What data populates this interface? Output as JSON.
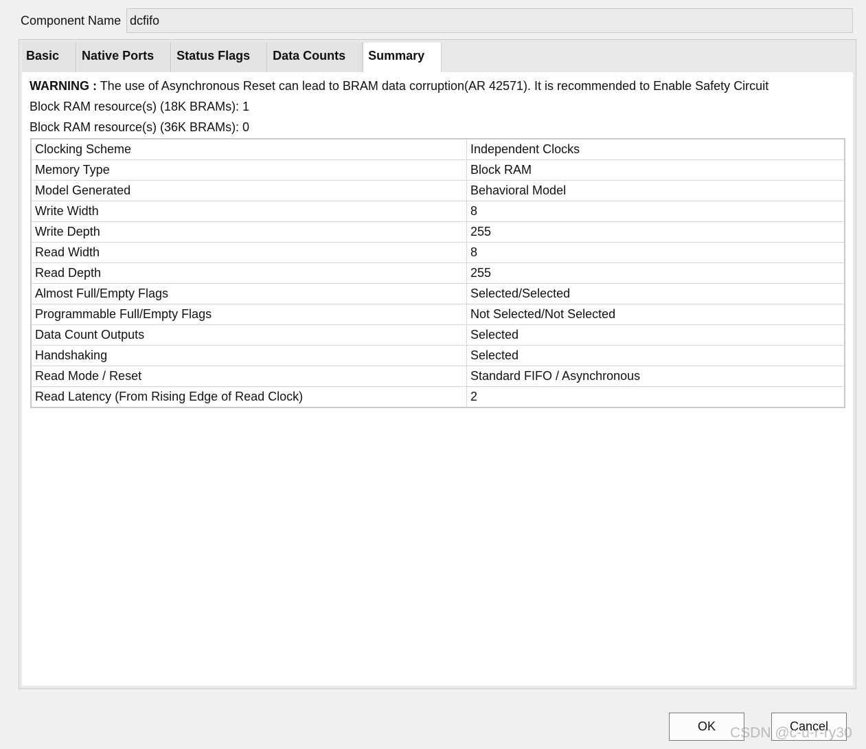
{
  "component": {
    "label": "Component Name",
    "value": "dcfifo"
  },
  "tabs": [
    {
      "label": "Basic",
      "active": false
    },
    {
      "label": "Native Ports",
      "active": false
    },
    {
      "label": "Status Flags",
      "active": false
    },
    {
      "label": "Data Counts",
      "active": false
    },
    {
      "label": "Summary",
      "active": true
    }
  ],
  "summary": {
    "warning_label": "WARNING :",
    "warning_text": "The use of Asynchronous Reset can lead to BRAM data corruption(AR 42571). It is recommended to Enable Safety Circuit",
    "bram18": "Block RAM resource(s) (18K BRAMs): 1",
    "bram36": "Block RAM resource(s) (36K BRAMs): 0",
    "rows": [
      {
        "key": "Clocking Scheme",
        "value": "Independent Clocks"
      },
      {
        "key": "Memory Type",
        "value": "Block RAM"
      },
      {
        "key": "Model Generated",
        "value": "Behavioral Model"
      },
      {
        "key": "Write Width",
        "value": "8"
      },
      {
        "key": "Write Depth",
        "value": "255"
      },
      {
        "key": "Read Width",
        "value": "8"
      },
      {
        "key": "Read Depth",
        "value": "255"
      },
      {
        "key": "Almost Full/Empty Flags",
        "value": "Selected/Selected"
      },
      {
        "key": "Programmable Full/Empty Flags",
        "value": "Not Selected/Not Selected"
      },
      {
        "key": "Data Count Outputs",
        "value": "Selected"
      },
      {
        "key": "Handshaking",
        "value": "Selected"
      },
      {
        "key": "Read Mode / Reset",
        "value": "Standard FIFO / Asynchronous"
      },
      {
        "key": "Read Latency (From Rising Edge of Read Clock)",
        "value": "2"
      }
    ]
  },
  "buttons": {
    "ok": "OK",
    "cancel": "Cancel"
  },
  "watermark": "CSDN @c-u-r-ry30"
}
